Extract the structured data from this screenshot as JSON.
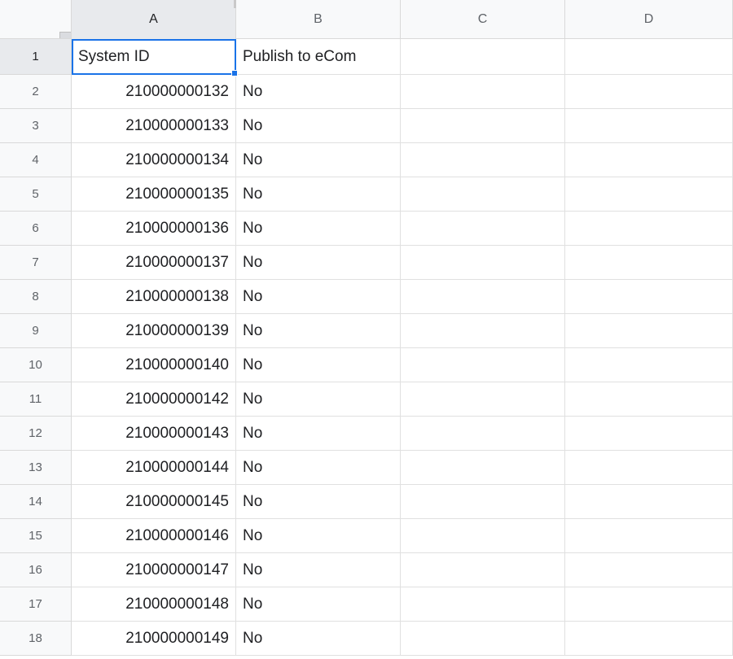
{
  "columns": [
    "A",
    "B",
    "C",
    "D"
  ],
  "active_column_index": 0,
  "active_row_index": 0,
  "rows": [
    {
      "num": "1",
      "cells": [
        "System ID",
        "Publish to eCom",
        "",
        ""
      ],
      "colA_is_text": true
    },
    {
      "num": "2",
      "cells": [
        "210000000132",
        "No",
        "",
        ""
      ]
    },
    {
      "num": "3",
      "cells": [
        "210000000133",
        "No",
        "",
        ""
      ]
    },
    {
      "num": "4",
      "cells": [
        "210000000134",
        "No",
        "",
        ""
      ]
    },
    {
      "num": "5",
      "cells": [
        "210000000135",
        "No",
        "",
        ""
      ]
    },
    {
      "num": "6",
      "cells": [
        "210000000136",
        "No",
        "",
        ""
      ]
    },
    {
      "num": "7",
      "cells": [
        "210000000137",
        "No",
        "",
        ""
      ]
    },
    {
      "num": "8",
      "cells": [
        "210000000138",
        "No",
        "",
        ""
      ]
    },
    {
      "num": "9",
      "cells": [
        "210000000139",
        "No",
        "",
        ""
      ]
    },
    {
      "num": "10",
      "cells": [
        "210000000140",
        "No",
        "",
        ""
      ]
    },
    {
      "num": "11",
      "cells": [
        "210000000142",
        "No",
        "",
        ""
      ]
    },
    {
      "num": "12",
      "cells": [
        "210000000143",
        "No",
        "",
        ""
      ]
    },
    {
      "num": "13",
      "cells": [
        "210000000144",
        "No",
        "",
        ""
      ]
    },
    {
      "num": "14",
      "cells": [
        "210000000145",
        "No",
        "",
        ""
      ]
    },
    {
      "num": "15",
      "cells": [
        "210000000146",
        "No",
        "",
        ""
      ]
    },
    {
      "num": "16",
      "cells": [
        "210000000147",
        "No",
        "",
        ""
      ]
    },
    {
      "num": "17",
      "cells": [
        "210000000148",
        "No",
        "",
        ""
      ]
    },
    {
      "num": "18",
      "cells": [
        "210000000149",
        "No",
        "",
        ""
      ]
    }
  ]
}
